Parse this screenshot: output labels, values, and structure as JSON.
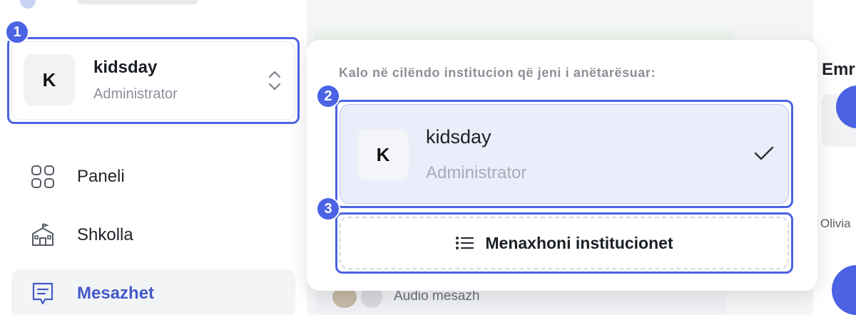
{
  "sidebar": {
    "org": {
      "initial": "K",
      "name": "kidsday",
      "role": "Administrator"
    },
    "nav": [
      {
        "label": "Paneli",
        "icon": "grid-icon",
        "active": false
      },
      {
        "label": "Shkolla",
        "icon": "school-icon",
        "active": false
      },
      {
        "label": "Mesazhet",
        "icon": "message-icon",
        "active": true
      }
    ]
  },
  "dropdown": {
    "heading": "Kalo në cilëndo institucion që jeni i anëtarësuar:",
    "item": {
      "initial": "K",
      "name": "kidsday",
      "role": "Administrator",
      "selected": true
    },
    "manage_label": "Menaxhoni institucionet"
  },
  "background": {
    "audio_label": "Audio mesazh",
    "right_title": "Emr",
    "right_name": "Olivia"
  },
  "annotations": [
    "1",
    "2",
    "3"
  ],
  "colors": {
    "accent": "#4b63e4",
    "active_nav": "#4459c9",
    "selected_bg": "#eaedfa"
  }
}
